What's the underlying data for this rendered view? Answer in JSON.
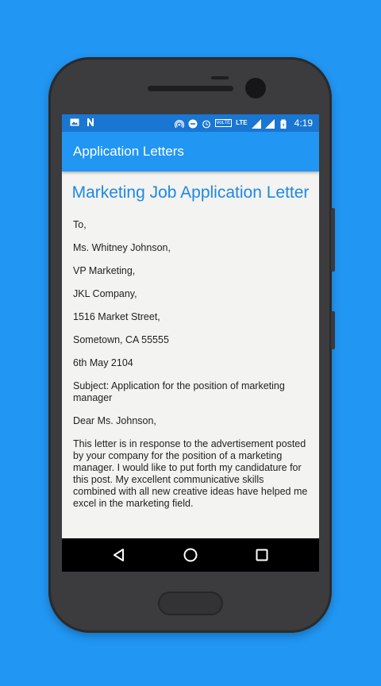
{
  "status_bar": {
    "time": "4:19",
    "volte": "VoLTE",
    "lte": "LTE"
  },
  "app_bar": {
    "title": "Application Letters"
  },
  "letter": {
    "title": "Marketing Job Application Letter",
    "lines": [
      "To,",
      "Ms. Whitney Johnson,",
      "VP Marketing,",
      "JKL Company,",
      "1516 Market Street,",
      "Sometown, CA 55555",
      "6th May 2104",
      "Subject: Application for the position of marketing manager",
      "Dear Ms. Johnson,",
      "This letter is in response to the advertisement posted by your company for the position of a marketing manager. I would like to put forth my candidature for this post. My excellent communicative skills combined with all new creative ideas have helped me excel in the marketing field."
    ]
  },
  "nav": {
    "back": "back-icon",
    "home": "home-icon",
    "recents": "recents-icon"
  },
  "colors": {
    "background": "#2196F3",
    "status_bar": "#1976D2",
    "app_bar": "#2196F3",
    "title_text": "#1E88E5"
  }
}
